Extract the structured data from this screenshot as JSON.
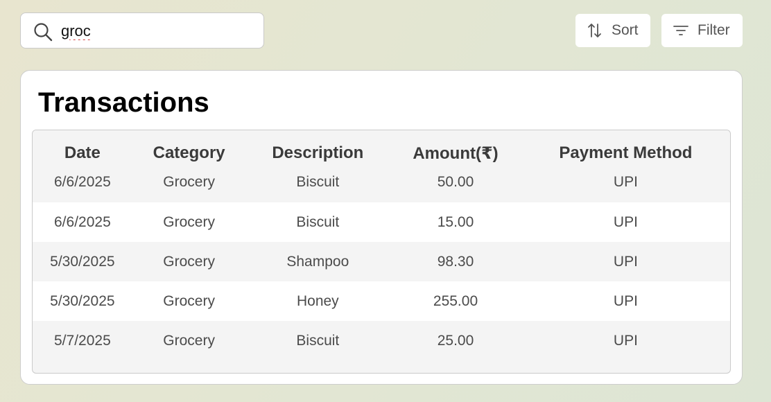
{
  "search": {
    "value": "groc",
    "icon": "search-icon"
  },
  "toolbar": {
    "sort_label": "Sort",
    "sort_icon": "sort-arrows-icon",
    "filter_label": "Filter",
    "filter_icon": "filter-lines-icon"
  },
  "card": {
    "title": "Transactions"
  },
  "table": {
    "columns": [
      "Date",
      "Category",
      "Description",
      "Amount(₹)",
      "Payment Method"
    ],
    "rows": [
      [
        "6/6/2025",
        "Grocery",
        "Biscuit",
        "50.00",
        "UPI"
      ],
      [
        "6/6/2025",
        "Grocery",
        "Biscuit",
        "15.00",
        "UPI"
      ],
      [
        "5/30/2025",
        "Grocery",
        "Shampoo",
        "98.30",
        "UPI"
      ],
      [
        "5/30/2025",
        "Grocery",
        "Honey",
        "255.00",
        "UPI"
      ],
      [
        "5/7/2025",
        "Grocery",
        "Biscuit",
        "25.00",
        "UPI"
      ]
    ]
  },
  "colors": {
    "row_alt": "#f4f4f4",
    "row": "#ffffff",
    "text": "#4b4b4b",
    "header_text": "#3a3a3a"
  }
}
